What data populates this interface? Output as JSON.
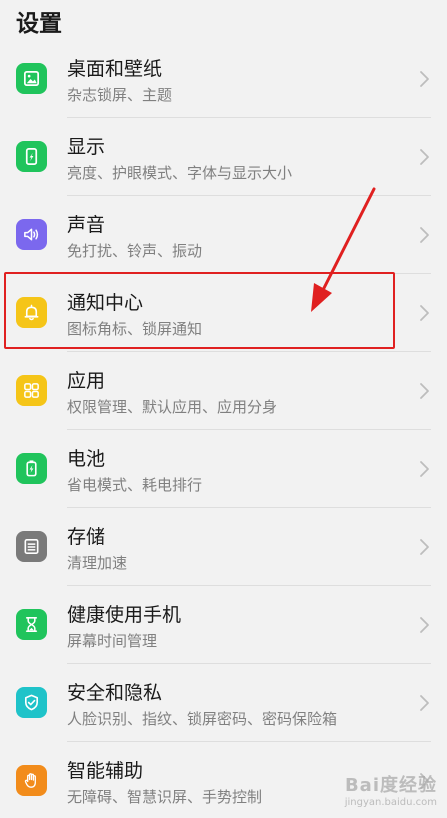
{
  "header": {
    "title": "设置"
  },
  "settings": [
    {
      "title": "桌面和壁纸",
      "subtitle": "杂志锁屏、主题",
      "icon": "wallpaper-icon",
      "color": "#20c45c",
      "name": "wallpaper"
    },
    {
      "title": "显示",
      "subtitle": "亮度、护眼模式、字体与显示大小",
      "icon": "display-icon",
      "color": "#20c45c",
      "name": "display"
    },
    {
      "title": "声音",
      "subtitle": "免打扰、铃声、振动",
      "icon": "speaker-icon",
      "color": "#7b68ee",
      "name": "sound"
    },
    {
      "title": "通知中心",
      "subtitle": "图标角标、锁屏通知",
      "icon": "bell-icon",
      "color": "#f5c518",
      "name": "notifications"
    },
    {
      "title": "应用",
      "subtitle": "权限管理、默认应用、应用分身",
      "icon": "apps-grid-icon",
      "color": "#f5c518",
      "name": "apps"
    },
    {
      "title": "电池",
      "subtitle": "省电模式、耗电排行",
      "icon": "battery-icon",
      "color": "#20c45c",
      "name": "battery"
    },
    {
      "title": "存储",
      "subtitle": "清理加速",
      "icon": "storage-icon",
      "color": "#7a7a7a",
      "name": "storage"
    },
    {
      "title": "健康使用手机",
      "subtitle": "屏幕时间管理",
      "icon": "hourglass-icon",
      "color": "#20c45c",
      "name": "digital-balance"
    },
    {
      "title": "安全和隐私",
      "subtitle": "人脸识别、指纹、锁屏密码、密码保险箱",
      "icon": "shield-icon",
      "color": "#1fc3c9",
      "name": "security-privacy"
    },
    {
      "title": "智能辅助",
      "subtitle": "无障碍、智慧识屏、手势控制",
      "icon": "hand-icon",
      "color": "#f28c1b",
      "name": "smart-assist"
    }
  ],
  "annotation": {
    "color": "#e02020"
  },
  "watermark": {
    "brand": "Bai度经验",
    "url": "jingyan.baidu.com"
  }
}
